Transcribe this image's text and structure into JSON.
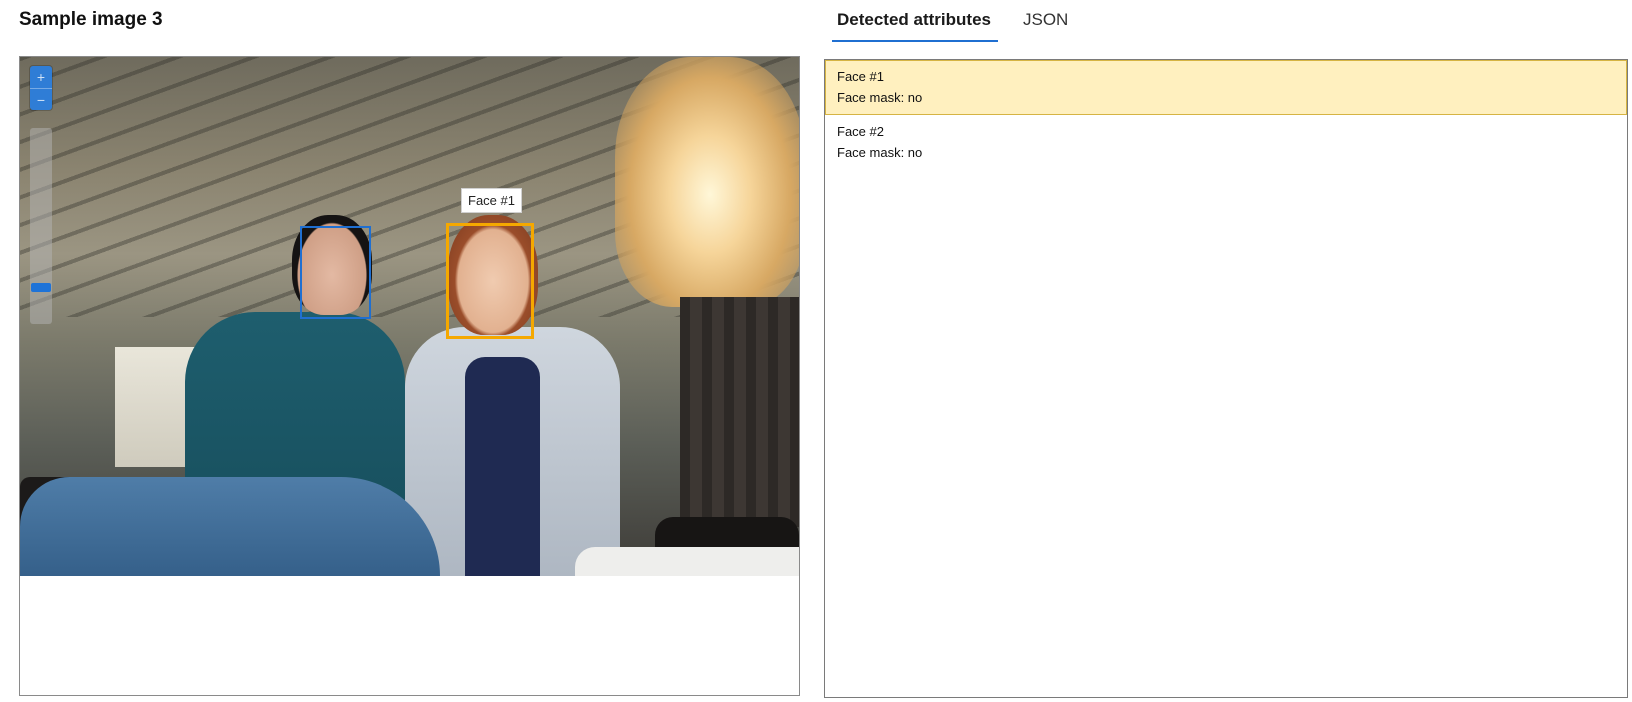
{
  "title": "Sample image 3",
  "tabs": [
    {
      "label": "Detected attributes",
      "active": true
    },
    {
      "label": "JSON",
      "active": false
    }
  ],
  "viewer": {
    "zoom_in_icon": "plus-icon",
    "zoom_out_icon": "minus-icon",
    "zoom_level": 0.1,
    "face_tooltip": "Face #1",
    "selected_box_color": "#f5a800",
    "box_color": "#1f6fd1"
  },
  "faces": [
    {
      "name": "Face #1",
      "attribute": "Face mask: no",
      "selected": true
    },
    {
      "name": "Face #2",
      "attribute": "Face mask: no",
      "selected": false
    }
  ],
  "colors": {
    "accent": "#1f6fd1",
    "selected_row": "#fff0bf"
  }
}
